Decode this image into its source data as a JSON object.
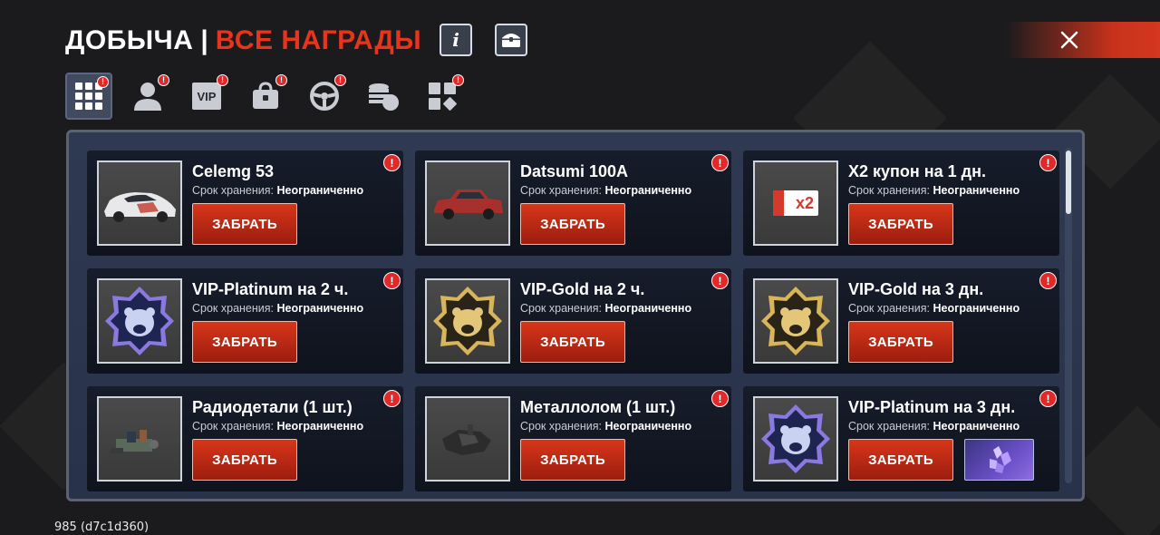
{
  "header": {
    "title": "ДОБЫЧА",
    "separator": "|",
    "subtitle": "ВСЕ НАГРАДЫ",
    "info_icon_label": "i"
  },
  "tabs": [
    {
      "icon": "grid-icon",
      "badge": "!"
    },
    {
      "icon": "user-icon",
      "badge": "!"
    },
    {
      "icon": "vip-icon",
      "label": "VIP",
      "badge": "!"
    },
    {
      "icon": "bag-icon",
      "badge": "!"
    },
    {
      "icon": "steering-wheel-icon",
      "badge": "!"
    },
    {
      "icon": "coins-icon"
    },
    {
      "icon": "puzzle-icon",
      "badge": "!"
    }
  ],
  "storage_label": "Срок хранения:",
  "storage_value": "Неограниченно",
  "claim_label": "ЗАБРАТЬ",
  "badge_mark": "!",
  "coupon_text": "x2",
  "rewards": [
    {
      "name": "Celemg 53",
      "icon": "white-car-icon"
    },
    {
      "name": "Datsumi 100A",
      "icon": "red-car-icon"
    },
    {
      "name": "X2 купон на 1 дн.",
      "icon": "coupon-icon"
    },
    {
      "name": "VIP-Platinum на 2 ч.",
      "icon": "vip-platinum-bear-icon"
    },
    {
      "name": "VIP-Gold на 2 ч.",
      "icon": "vip-gold-bear-icon"
    },
    {
      "name": "VIP-Gold на 3 дн.",
      "icon": "vip-gold-bear-icon"
    },
    {
      "name": "Радиодетали (1 шт.)",
      "icon": "radio-parts-icon"
    },
    {
      "name": "Металлолом (1 шт.)",
      "icon": "scrap-metal-icon"
    },
    {
      "name": "VIP-Platinum на 3 дн.",
      "icon": "vip-platinum-bear-icon",
      "extra_icon": "crystal-icon"
    }
  ],
  "version": "985 (d7c1d360)",
  "colors": {
    "accent": "#e8341c",
    "background": "#1b1b1d",
    "panel": "#2c3650",
    "badge": "#e02a2a"
  }
}
